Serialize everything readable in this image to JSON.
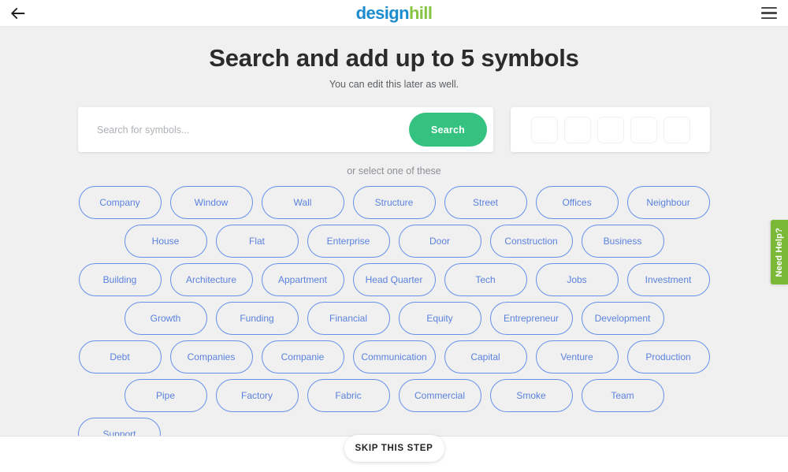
{
  "topbar": {
    "back_label": "Back",
    "logo_part1": "design",
    "logo_part2": "hill",
    "menu_label": "Menu",
    "logo_color_1": "#1b8cd0",
    "logo_color_2": "#86c442"
  },
  "header": {
    "title": "Search and add up to 5 symbols",
    "subtitle": "You can edit this later as well."
  },
  "search": {
    "placeholder": "Search for symbols...",
    "value": "",
    "button_label": "Search",
    "button_color": "#35c281",
    "slot_count": 5
  },
  "suggestions": {
    "label": "or select one of these",
    "chip_border_color": "#6691ea",
    "chip_text_color": "#5b82dd",
    "rows": [
      [
        "Company",
        "Window",
        "Wall",
        "Structure",
        "Street",
        "Offices",
        "Neighbour"
      ],
      [
        "House",
        "Flat",
        "Enterprise",
        "Door",
        "Construction",
        "Business"
      ],
      [
        "Building",
        "Architecture",
        "Appartment",
        "Head Quarter",
        "Tech",
        "Jobs",
        "Investment"
      ],
      [
        "Growth",
        "Funding",
        "Financial",
        "Equity",
        "Entrepreneur",
        "Development"
      ],
      [
        "Debt",
        "Companies",
        "Companie",
        "Communication",
        "Capital",
        "Venture",
        "Production"
      ],
      [
        "Pipe",
        "Factory",
        "Fabric",
        "Commercial",
        "Smoke",
        "Team"
      ],
      [
        "Support"
      ]
    ]
  },
  "help_tab": {
    "label": "Need Help?",
    "color": "#7ab838"
  },
  "footer": {
    "skip_label": "SKIP THIS STEP"
  }
}
